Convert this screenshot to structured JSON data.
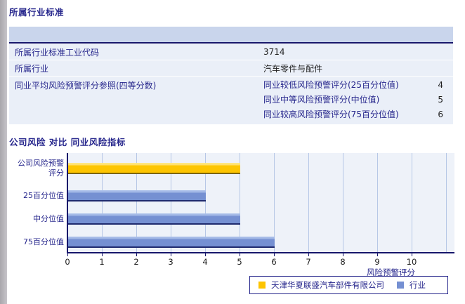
{
  "colors": {
    "accent_navy": "#26268c",
    "table_header_bg": "#c9d5ec",
    "table_row_bg": "#eaeff8",
    "company_bar": "#fdc400",
    "industry_bar": "#7590d2",
    "plot_bg": "#eef2f9",
    "gridline": "#b6c7e6"
  },
  "section1": {
    "title": "所属行业标准",
    "rows": [
      {
        "label": "所属行业标准工业代码",
        "value": "3714"
      },
      {
        "label": "所属行业",
        "value": "汽车零件与配件"
      }
    ],
    "group_row": {
      "label": "同业平均风险预警评分参照(四等分数)",
      "items": [
        {
          "label": "同业较低风险预警评分(25百分位值)",
          "value": "4"
        },
        {
          "label": "同业中等风险预警评分(中位值)",
          "value": "5"
        },
        {
          "label": "同业较高风险预警评分(75百分位值)",
          "value": "6"
        }
      ]
    }
  },
  "section2": {
    "title": "公司风险 对比 同业风险指标"
  },
  "chart_data": {
    "type": "bar",
    "orientation": "horizontal",
    "categories": [
      "公司风险预警评分",
      "25百分位值",
      "中分位值",
      "75百分位值"
    ],
    "category_label_lines": [
      [
        "公司风险预警",
        "评分"
      ],
      [
        "25百分位值"
      ],
      [
        "中分位值"
      ],
      [
        "75百分位值"
      ]
    ],
    "series": [
      {
        "name": "天津华夏联盛汽车部件有限公司",
        "color": "#fdc400",
        "values": [
          5,
          null,
          null,
          null
        ]
      },
      {
        "name": "行业",
        "color": "#7590d2",
        "values": [
          null,
          4,
          5,
          6
        ]
      }
    ],
    "bar_values_by_category": [
      5,
      4,
      5,
      6
    ],
    "bar_series_by_category": [
      "company",
      "industry",
      "industry",
      "industry"
    ],
    "xlabel": "风险预警评分",
    "xlim": [
      0,
      11.2
    ],
    "xticks": [
      0,
      1,
      2,
      3,
      4,
      5,
      6,
      7,
      8,
      9,
      10
    ],
    "grid": true,
    "legend_position": "bottom",
    "legend": [
      {
        "name": "天津华夏联盛汽车部件有限公司",
        "swatch": "company"
      },
      {
        "name": "行业",
        "swatch": "industry"
      }
    ]
  }
}
